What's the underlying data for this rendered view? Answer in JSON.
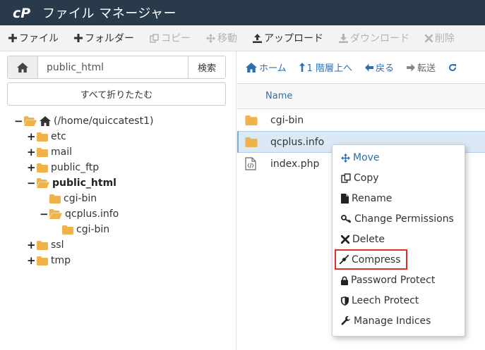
{
  "header": {
    "title": "ファイル マネージャー",
    "logo": "cP"
  },
  "toolbar": {
    "items": [
      {
        "label": "ファイル",
        "icon": "plus-icon",
        "disabled": false
      },
      {
        "label": "フォルダー",
        "icon": "plus-icon",
        "disabled": false
      },
      {
        "label": "コピー",
        "icon": "copy-icon",
        "disabled": true
      },
      {
        "label": "移動",
        "icon": "move-icon",
        "disabled": true
      },
      {
        "label": "アップロード",
        "icon": "upload-icon",
        "disabled": false
      },
      {
        "label": "ダウンロード",
        "icon": "download-icon",
        "disabled": true
      },
      {
        "label": "削除",
        "icon": "close-icon",
        "disabled": true
      }
    ]
  },
  "sidebar": {
    "path_value": "public_html",
    "search_label": "検索",
    "collapse_label": "すべて折りたたむ",
    "tree": [
      {
        "label": "(/home/quiccatest1)",
        "toggle": "−",
        "open": true,
        "home": true
      },
      {
        "label": "etc",
        "toggle": "+",
        "open": false
      },
      {
        "label": "mail",
        "toggle": "+",
        "open": false
      },
      {
        "label": "public_ftp",
        "toggle": "+",
        "open": false
      },
      {
        "label": "public_html",
        "toggle": "−",
        "open": true,
        "bold": true
      },
      {
        "label": "cgi-bin",
        "toggle": "",
        "open": false
      },
      {
        "label": "qcplus.info",
        "toggle": "−",
        "open": true
      },
      {
        "label": "cgi-bin",
        "toggle": "",
        "open": false
      },
      {
        "label": "ssl",
        "toggle": "+",
        "open": false
      },
      {
        "label": "tmp",
        "toggle": "+",
        "open": false
      }
    ]
  },
  "nav": {
    "home_label": "ホーム",
    "up_label": "1 階層上へ",
    "back_label": "戻る",
    "forward_label": "転送"
  },
  "list": {
    "name_header": "Name",
    "files": [
      {
        "name": "cgi-bin",
        "type": "folder",
        "selected": false
      },
      {
        "name": "qcplus.info",
        "type": "folder",
        "selected": true
      },
      {
        "name": "index.php",
        "type": "code-file",
        "selected": false
      }
    ]
  },
  "context_menu": {
    "items": [
      {
        "label": "Move",
        "icon": "move-icon"
      },
      {
        "label": "Copy",
        "icon": "copy-icon"
      },
      {
        "label": "Rename",
        "icon": "file-icon"
      },
      {
        "label": "Change Permissions",
        "icon": "key-icon"
      },
      {
        "label": "Delete",
        "icon": "close-icon"
      },
      {
        "label": "Compress",
        "icon": "compress-icon",
        "highlighted": true
      },
      {
        "label": "Password Protect",
        "icon": "lock-icon"
      },
      {
        "label": "Leech Protect",
        "icon": "shield-icon"
      },
      {
        "label": "Manage Indices",
        "icon": "wrench-icon"
      }
    ]
  },
  "colors": {
    "header_bg": "#293a4a",
    "link_blue": "#2a6fb0",
    "folder_yellow": "#f0b34b",
    "selected_row": "#dbe9f6",
    "highlight_red": "#d9302c"
  }
}
